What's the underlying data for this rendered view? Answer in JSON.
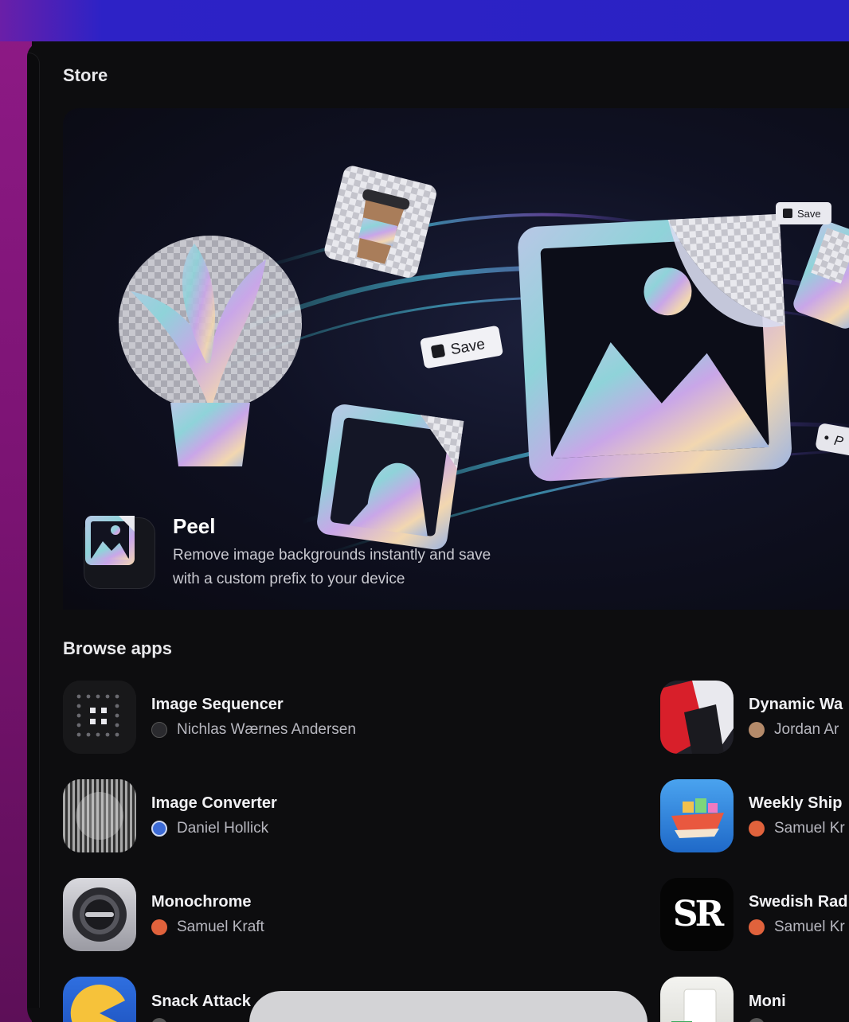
{
  "page": {
    "title": "Store"
  },
  "featured": {
    "app_name": "Peel",
    "description": "Remove image backgrounds instantly and save with a custom prefix to your device",
    "sticker_save_label": "Save",
    "sticker_save_small_label": "Save",
    "sticker_partial_label": "P"
  },
  "browse": {
    "title": "Browse apps",
    "apps": [
      {
        "name": "Image Sequencer",
        "author": "Nichlas Wærnes Andersen"
      },
      {
        "name": "Dynamic Wa",
        "author": "Jordan Ar"
      },
      {
        "name": "Image Converter",
        "author": "Daniel Hollick"
      },
      {
        "name": "Weekly Ship",
        "author": "Samuel Kr"
      },
      {
        "name": "Monochrome",
        "author": "Samuel Kraft"
      },
      {
        "name": "Swedish Rad",
        "author": "Samuel Kr"
      },
      {
        "name": "Snack Attack",
        "author": ""
      },
      {
        "name": "Moni",
        "author": ""
      }
    ]
  },
  "colors": {
    "background": "#0d0d0f",
    "accent_top": "#2a22c4",
    "accent_side": "#8e1a86"
  }
}
